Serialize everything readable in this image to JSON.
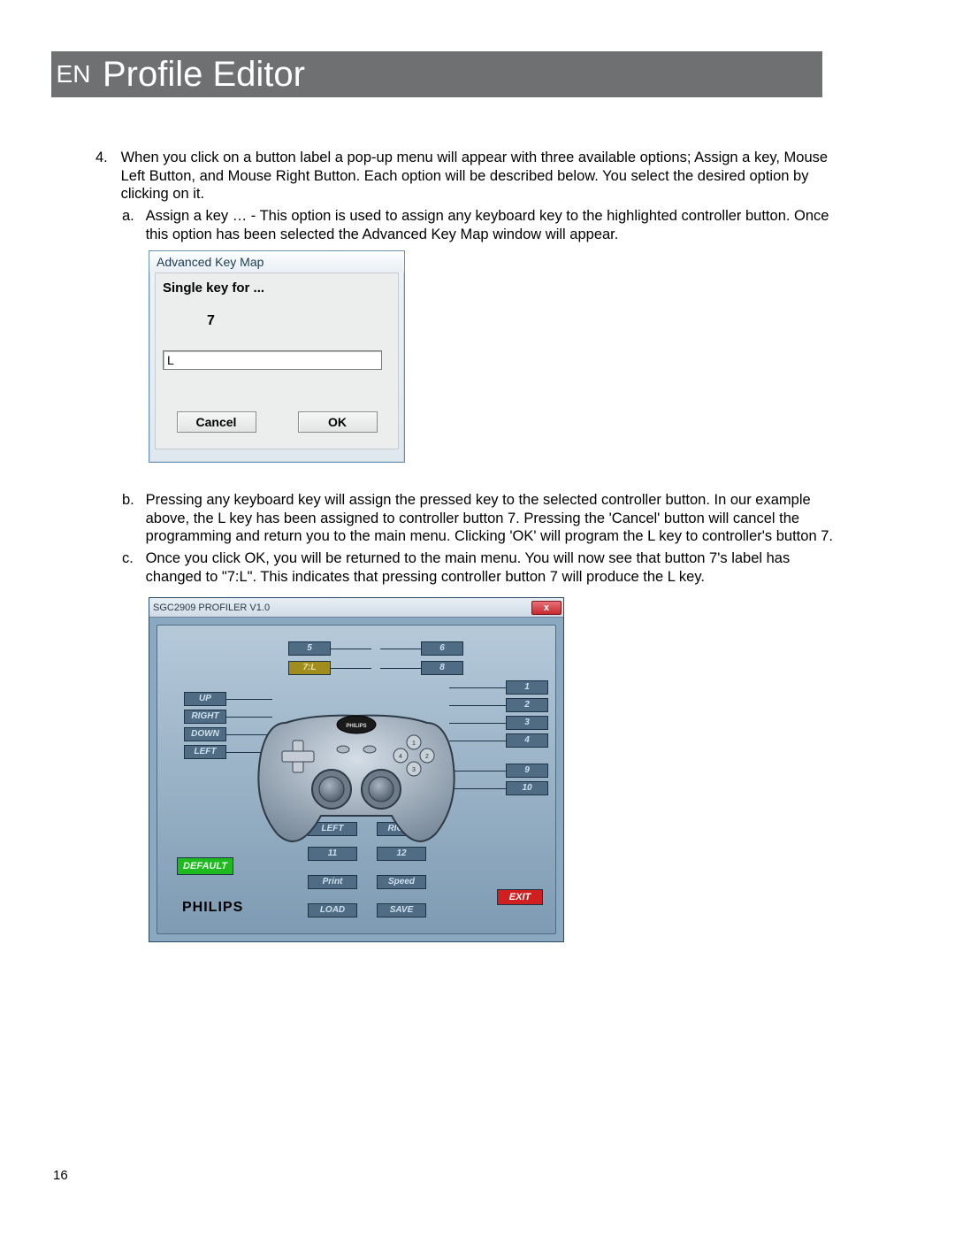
{
  "header": {
    "lang": "EN",
    "title": "Profile Editor"
  },
  "para4": {
    "num": "4.",
    "text": "When you click on a button label a pop-up menu will appear with three available options; Assign a key, Mouse Left Button, and Mouse Right Button. Each option will be described below. You select the desired option by clicking on it.",
    "a_letter": "a.",
    "a_text": "Assign a key … - This option is used to assign any keyboard key to the highlighted controller button. Once this option has been selected the Advanced Key Map window will appear."
  },
  "akm": {
    "title": "Advanced Key Map",
    "label": "Single key for ...",
    "seven": "7",
    "input_value": "L",
    "cancel": "Cancel",
    "ok": "OK"
  },
  "parab": {
    "letter": "b.",
    "text": "Pressing any keyboard key will assign the pressed key to the selected controller button. In our example above, the L key has been assigned to controller button 7. Pressing the 'Cancel' button will cancel the programming and return you to the main menu. Clicking 'OK' will program the L key to controller's button 7."
  },
  "parac": {
    "letter": "c.",
    "text": "Once you click OK, you will be returned to the main menu. You will now see that button 7's label has changed to \"7:L\". This indicates that pressing controller button 7 will produce the L key."
  },
  "profiler": {
    "title": "SGC2909 PROFILER V1.0",
    "close": "x",
    "labels": {
      "l5": "5",
      "l6": "6",
      "l7": "7:L",
      "l8": "8",
      "up": "UP",
      "right": "RIGHT",
      "down": "DOWN",
      "left": "LEFT",
      "r1": "1",
      "r2": "2",
      "r3": "3",
      "r4": "4",
      "r9": "9",
      "r10": "10",
      "bleft": "LEFT",
      "bright": "RIGHT",
      "l11": "11",
      "l12": "12",
      "print": "Print",
      "speed": "Speed",
      "load": "LOAD",
      "save": "SAVE",
      "default": "DEFAULT",
      "exit": "EXIT"
    },
    "brand": "PHILIPS",
    "badge": "PHILIPS"
  },
  "page": "16"
}
